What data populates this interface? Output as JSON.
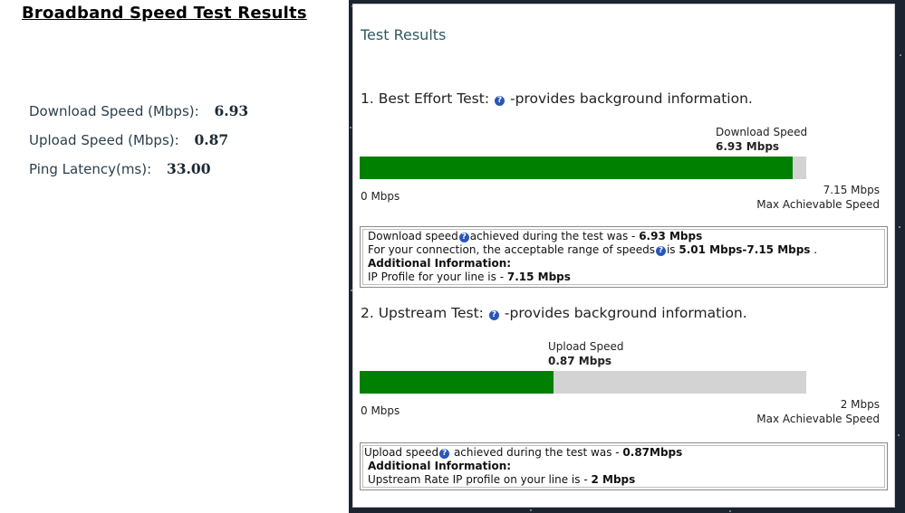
{
  "page_title": "Broadband Speed Test Results",
  "summary": {
    "download_label": "Download Speed (Mbps):",
    "download_value": "6.93",
    "upload_label": "Upload Speed (Mbps):",
    "upload_value": "0.87",
    "ping_label": "Ping Latency(ms):",
    "ping_value": "33.00"
  },
  "results": {
    "heading": "Test Results",
    "help_glyph": "?",
    "best_effort": {
      "heading_prefix": "1. Best Effort Test:",
      "heading_suffix": "-provides background information.",
      "bar_label": "Download Speed",
      "bar_value_text": "6.93 Mbps",
      "measured": 6.93,
      "max": 7.15,
      "axis_min": "0 Mbps",
      "axis_max_value": "7.15 Mbps",
      "axis_max_caption": "Max Achievable Speed",
      "info": {
        "line1_text": "Download speed",
        "line1_mid": "achieved during the test was - ",
        "line1_value": "6.93 Mbps",
        "line2_text": "For your connection, the acceptable range of speeds",
        "line2_mid": "is ",
        "line2_value": "5.01 Mbps-7.15 Mbps",
        "line2_end": " .",
        "additional_heading": "Additional Information:",
        "line3_text": "IP Profile for your line is - ",
        "line3_value": "7.15 Mbps"
      }
    },
    "upstream": {
      "heading_prefix": "2. Upstream Test:",
      "heading_suffix": "-provides background information.",
      "bar_label": "Upload Speed",
      "bar_value_text": "0.87 Mbps",
      "measured": 0.87,
      "max": 2,
      "axis_min": "0 Mbps",
      "axis_max_value": "2 Mbps",
      "axis_max_caption": "Max Achievable Speed",
      "info": {
        "line1_text": "Upload speed",
        "line1_mid": " achieved during the test was - ",
        "line1_value": "0.87Mbps",
        "additional_heading": "Additional Information:",
        "line2_text": "Upstream Rate IP profile on your line is - ",
        "line2_value": "2 Mbps"
      }
    }
  },
  "colors": {
    "bar_fill": "#008000",
    "bar_track": "#d3d3d3",
    "help_icon": "#2a56b8",
    "results_heading": "#2f5a62"
  }
}
